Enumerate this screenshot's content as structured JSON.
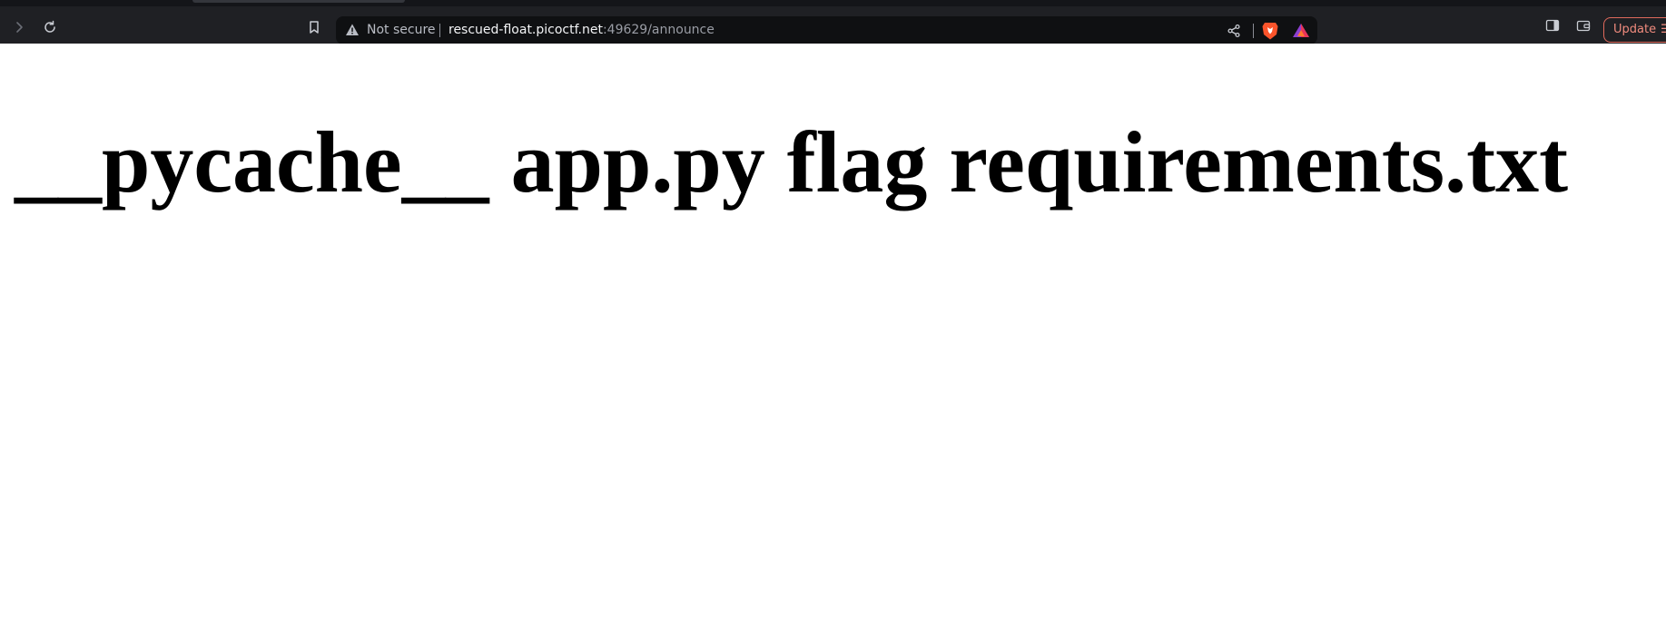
{
  "browser": {
    "address_bar": {
      "security_label": "Not secure",
      "url_host": "rescued-float.picoctf.net",
      "url_rest": ":49629/announce"
    },
    "update_label": "Update",
    "icons": {
      "forward": "chevron-right-icon",
      "reload": "reload-icon",
      "bookmark": "bookmark-icon",
      "warning": "warning-icon",
      "share": "share-icon",
      "brave_shields": "brave-lion-icon",
      "rewards": "brave-rewards-icon",
      "sidebar": "sidebar-icon",
      "wallet": "wallet-icon",
      "menu": "hamburger-menu-icon"
    },
    "colors": {
      "chrome_bg": "#1f2024",
      "urlbar_bg": "#0f1012",
      "update_accent": "#e06a5c"
    }
  },
  "page": {
    "heading": "__pycache__ app.py flag requirements.txt"
  }
}
